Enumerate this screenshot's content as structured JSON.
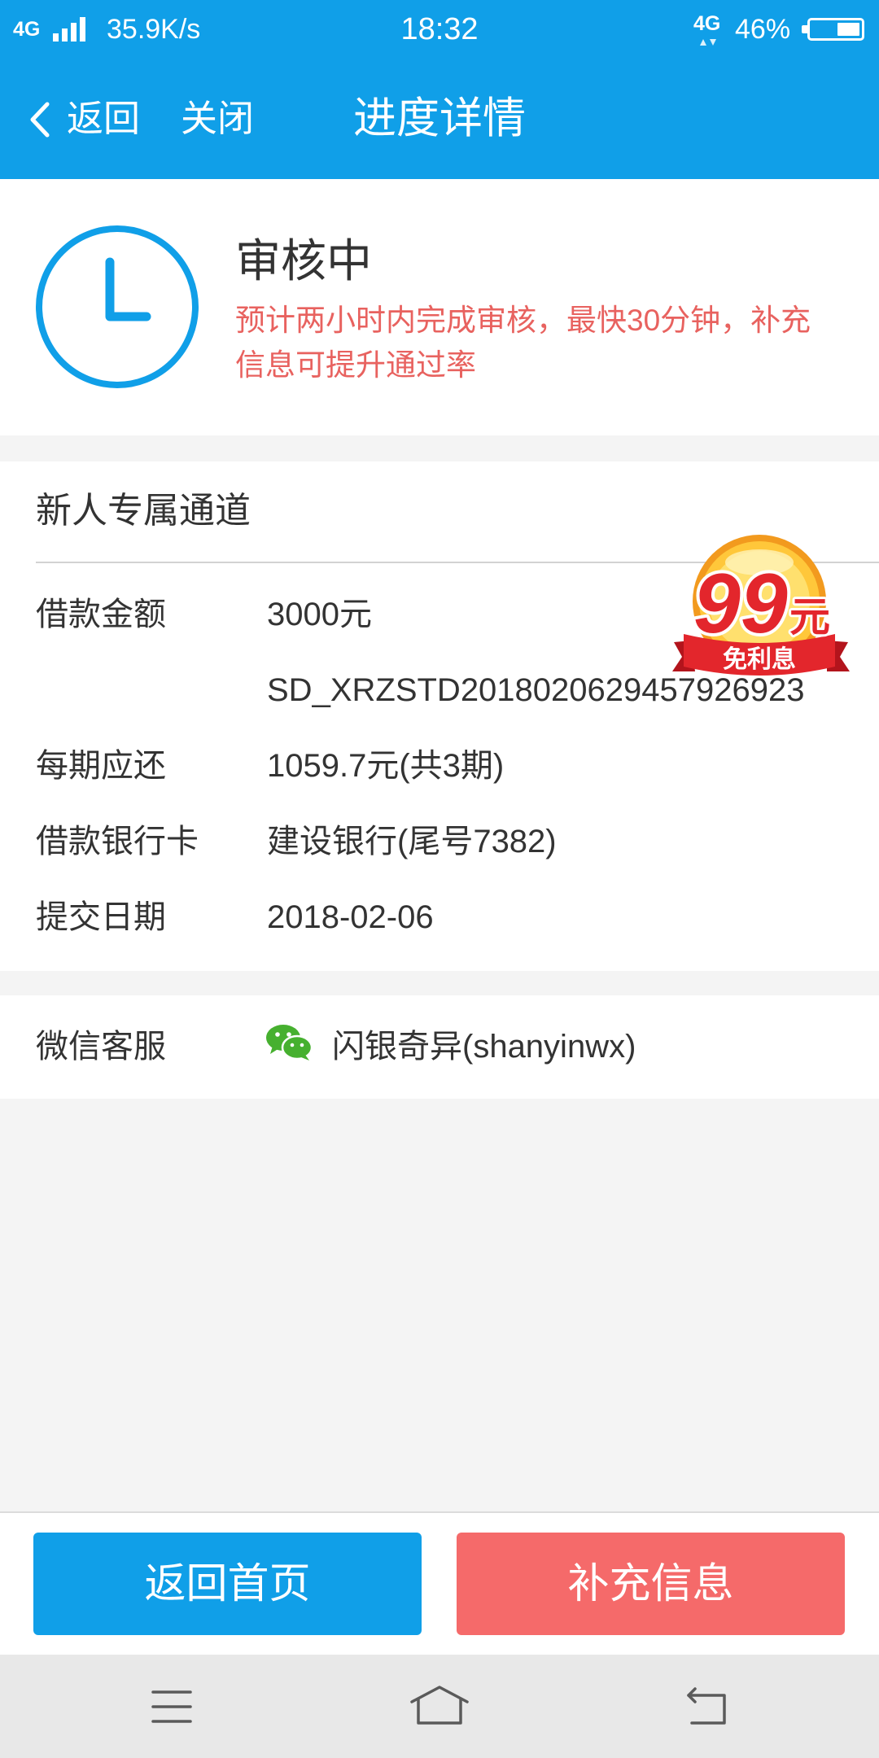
{
  "status_bar": {
    "network_left": "4G",
    "speed": "35.9K/s",
    "time": "18:32",
    "network_right": "4G",
    "battery": "46%",
    "battery_level": 0.46,
    "icons": [
      "signal-strength-icon",
      "data-activity-icon",
      "battery-icon"
    ]
  },
  "nav": {
    "back_icon": "chevron-left-icon",
    "back_label": "返回",
    "close_label": "关闭",
    "title": "进度详情"
  },
  "status": {
    "icon": "clock-icon",
    "title": "审核中",
    "message": "预计两小时内完成审核，最快30分钟，补充信息可提升通过率"
  },
  "loan": {
    "section_title": "新人专属通道",
    "badge": {
      "number": "99",
      "unit": "元",
      "ribbon": "免利息"
    },
    "rows": [
      {
        "label": "借款金额",
        "value": "3000元"
      },
      {
        "label": "",
        "value": "SD_XRZSTD2018020629457926923"
      },
      {
        "label": "每期应还",
        "value": "1059.7元(共3期)"
      },
      {
        "label": "借款银行卡",
        "value": "建设银行(尾号7382)"
      },
      {
        "label": "提交日期",
        "value": "2018-02-06"
      }
    ]
  },
  "support": {
    "label": "微信客服",
    "icon": "wechat-icon",
    "account": "闪银奇异(shanyinwx)"
  },
  "actions": {
    "home_label": "返回首页",
    "supplement_label": "补充信息"
  },
  "system_nav": {
    "icons": [
      "menu-icon",
      "home-icon",
      "back-icon"
    ]
  },
  "colors": {
    "primary": "#109FE8",
    "accent_red": "#F56A6A",
    "notice_text": "#E8625F",
    "wechat_green": "#46B02F"
  }
}
